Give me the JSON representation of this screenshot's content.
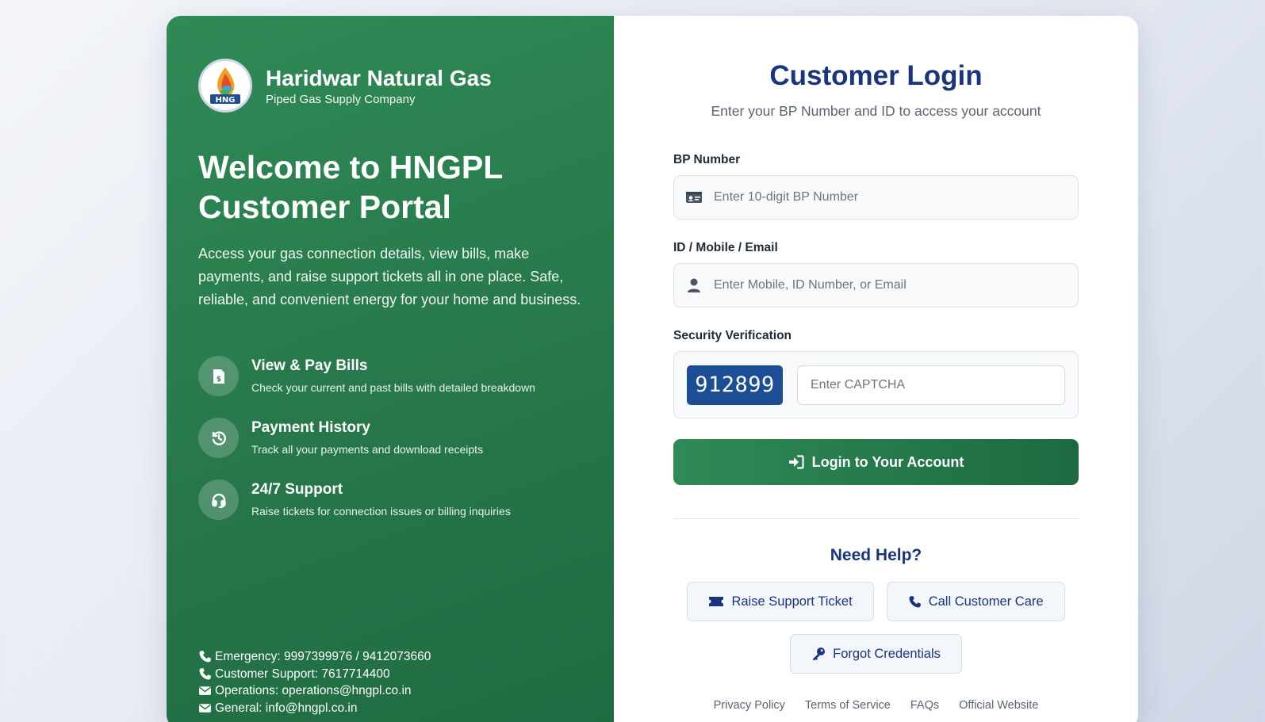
{
  "brand": {
    "name": "Haridwar Natural Gas",
    "tagline": "Piped Gas Supply Company",
    "logo_text": "HNG"
  },
  "left": {
    "welcome_line1": "Welcome to HNGPL",
    "welcome_line2": "Customer Portal",
    "intro": "Access your gas connection details, view bills, make payments, and raise support tickets all in one place. Safe, reliable, and convenient energy for your home and business.",
    "features": [
      {
        "icon": "bill-icon",
        "title": "View & Pay Bills",
        "desc": "Check your current and past bills with detailed breakdown"
      },
      {
        "icon": "history-icon",
        "title": "Payment History",
        "desc": "Track all your payments and download receipts"
      },
      {
        "icon": "headset-icon",
        "title": "24/7 Support",
        "desc": "Raise tickets for connection issues or billing inquiries"
      }
    ],
    "contacts": [
      {
        "icon": "phone-icon",
        "text": "Emergency: 9997399976 / 9412073660"
      },
      {
        "icon": "phone-icon",
        "text": "Customer Support: 7617714400"
      },
      {
        "icon": "envelope-icon",
        "text": "Operations: operations@hngpl.co.in"
      },
      {
        "icon": "envelope-icon",
        "text": "General: info@hngpl.co.in"
      }
    ]
  },
  "login": {
    "title": "Customer Login",
    "subtitle": "Enter your BP Number and ID to access your account",
    "bp_label": "BP Number",
    "bp_placeholder": "Enter 10-digit BP Number",
    "id_label": "ID / Mobile / Email",
    "id_placeholder": "Enter Mobile, ID Number, or Email",
    "security_label": "Security Verification",
    "captcha_code": "912899",
    "captcha_placeholder": "Enter CAPTCHA",
    "submit_label": "Login to Your Account"
  },
  "help": {
    "title": "Need Help?",
    "raise_ticket": "Raise Support Ticket",
    "call_care": "Call Customer Care",
    "forgot": "Forgot Credentials"
  },
  "footer": {
    "links": [
      "Privacy Policy",
      "Terms of Service",
      "FAQs",
      "Official Website"
    ]
  },
  "colors": {
    "brand_green": "#2f8a56",
    "brand_navy": "#1a347f",
    "captcha_blue": "#1c4e96"
  }
}
